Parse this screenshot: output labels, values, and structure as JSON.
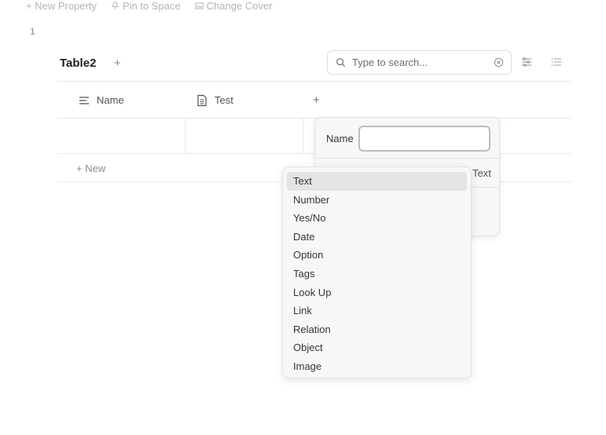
{
  "toolbar": {
    "items": [
      {
        "label": "+ New Property",
        "icon": "plus-icon"
      },
      {
        "label": "Pin to Space",
        "icon": "pin-icon"
      },
      {
        "label": "Change Cover",
        "icon": "image-icon"
      }
    ]
  },
  "line_number": "1",
  "table": {
    "title": "Table2",
    "add_view": "+",
    "search": {
      "placeholder": "Type to search..."
    },
    "columns": [
      {
        "label": "Name",
        "icon": "text-lines-icon"
      },
      {
        "label": "Test",
        "icon": "document-icon"
      }
    ],
    "add_column": "+",
    "new_row_label": "+ New"
  },
  "property_popup": {
    "name_label": "Name",
    "name_value": "",
    "type_value": "Text"
  },
  "type_menu": {
    "selected": "Text",
    "items": [
      "Text",
      "Number",
      "Yes/No",
      "Date",
      "Option",
      "Tags",
      "Look Up",
      "Link",
      "Relation",
      "Object",
      "Image"
    ]
  },
  "colors": {
    "border": "#e9e9e7",
    "menu_bg": "#f7f7f7",
    "selected_bg": "#e4e4e4",
    "muted_text": "#8a8a8a"
  }
}
